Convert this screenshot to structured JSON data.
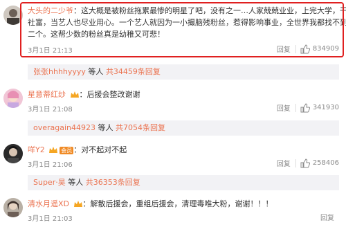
{
  "comments": [
    {
      "username": "大头的二少爷",
      "lines": [
        "：这大概是被粉丝拖累最惨的明星了吧，没有之一…人家兢兢业业，上完大学，干过",
        "社富，当艺人也尽业用心。一个艺人就因为一小撮脑残粉丝，惹得影响事业，全世界我都找不到第",
        "二个。这帮少数的粉丝真是幼稚又可悲！"
      ],
      "date": "3月1日 21:13",
      "reply_label": "回复",
      "likes": "834909"
    },
    {
      "username": "星意蒂红纱",
      "lines": [
        "：后援会整改谢谢"
      ],
      "date": "3月1日 21:08",
      "reply_label": "回复",
      "likes": "341930"
    },
    {
      "username": "咩Y2",
      "lines": [
        "：对不起对不起"
      ],
      "date": "3月1日 21:06",
      "reply_label": "回复",
      "likes": "258406"
    },
    {
      "username": "清水月遥XD",
      "lines": [
        "：解散后援会，重组后援会，清理毒唯大粉，谢谢！！！"
      ],
      "date": "3月1日 21:03",
      "reply_label": "回复"
    }
  ],
  "subreplies": [
    {
      "user": "张张hhhhyyyy",
      "mid": " 等人 ",
      "count": "共34459条回复"
    },
    {
      "user": "overagain44923",
      "mid": " 等人 ",
      "count": "共7054条回复"
    },
    {
      "user": "Super·昊",
      "mid": " 等人 ",
      "count": "共36353条回复"
    }
  ],
  "badge_text": "会员",
  "colors": {
    "username": "#eb7350",
    "highlight": "#e02020",
    "subreply_bg": "#f2f2f5"
  }
}
